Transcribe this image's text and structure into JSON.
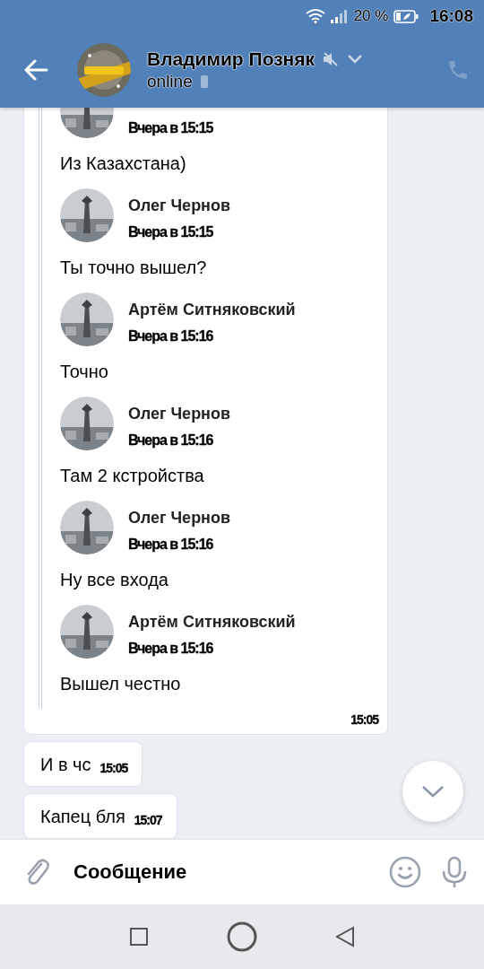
{
  "status_bar": {
    "battery": "20 %",
    "time": "16:08"
  },
  "header": {
    "title": "Владимир Позняк",
    "muted": true,
    "status": "online"
  },
  "messages": [
    {
      "kind": "forwarded",
      "time": "15:05",
      "items": [
        {
          "date": "Вчера в 15:15",
          "text": "Из Казахстана)"
        },
        {
          "author": "Олег Чернов",
          "date": "Вчера в 15:15",
          "text": "Ты точно вышел?"
        },
        {
          "author": "Артём Ситняковский",
          "date": "Вчера в 15:16",
          "text": "Точно"
        },
        {
          "author": "Олег Чернов",
          "date": "Вчера в 15:16",
          "text": "Там 2 кстройства"
        },
        {
          "author": "Олег Чернов",
          "date": "Вчера в 15:16",
          "text": "Ну все входа"
        },
        {
          "author": "Артём Ситняковский",
          "date": "Вчера в 15:16",
          "text": "Вышел честно"
        }
      ]
    },
    {
      "kind": "text",
      "text": "И в чс",
      "time": "15:05"
    },
    {
      "kind": "text",
      "text": "Капец бля",
      "time": "15:07"
    }
  ],
  "composer": {
    "placeholder": "Сообщение"
  }
}
